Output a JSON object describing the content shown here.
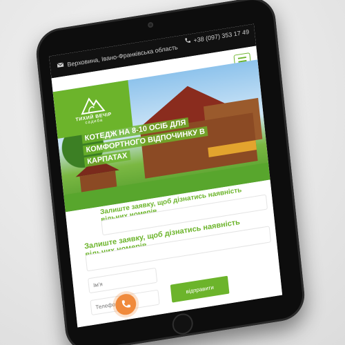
{
  "topbar": {
    "location": "Верховина, Івано-Франківська область",
    "phone": "+38 (097) 353 17 49"
  },
  "logo": {
    "name": "ТИХИЙ ВЕЧІР",
    "subtitle": "садиба"
  },
  "hero": {
    "title_line1": "КОТЕДЖ НА 8-10 ОСІБ ДЛЯ",
    "title_line2": "КОМФОРТНОГО ВІДПОЧИНКУ В КАРПАТАХ"
  },
  "form": {
    "availability_text": "Залиште заявку, щоб дізнатись наявність вільних номерів",
    "heading": "Залиште заявку, щоб дізнатись наявність вільних номерів",
    "name_placeholder": "Ім'я",
    "phone_placeholder": "Телефон",
    "submit_label": "відправити"
  },
  "colors": {
    "accent": "#6cb42b",
    "topbar_bg": "#111111",
    "call_button": "#f08a3c"
  },
  "icons": {
    "location": "mail-icon",
    "phone": "phone-icon",
    "menu": "hamburger-icon",
    "call": "phone-call-icon"
  }
}
